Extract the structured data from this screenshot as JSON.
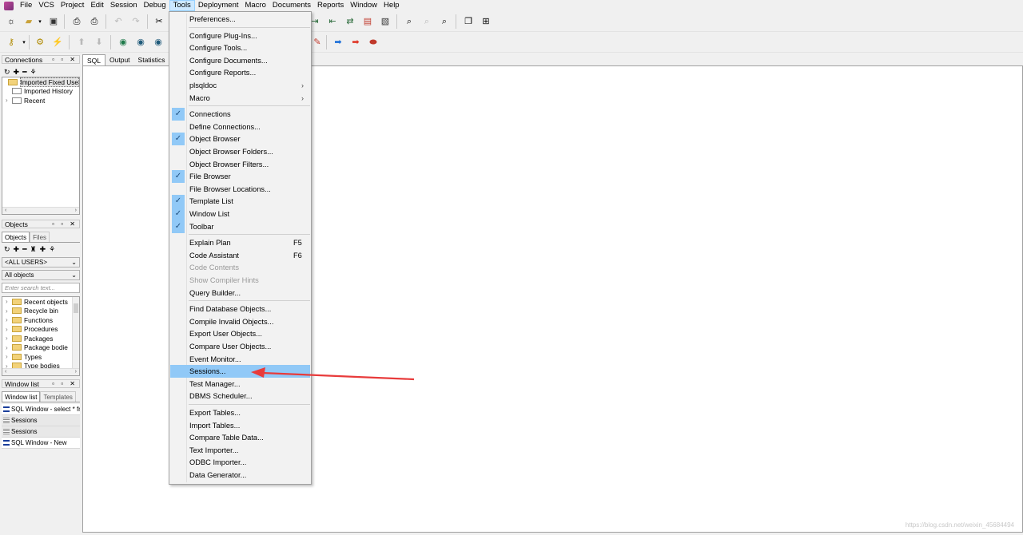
{
  "menubar": {
    "items": [
      "File",
      "VCS",
      "Project",
      "Edit",
      "Session",
      "Debug",
      "Tools",
      "Deployment",
      "Macro",
      "Documents",
      "Reports",
      "Window",
      "Help"
    ],
    "active": "Tools"
  },
  "panels": {
    "connections": {
      "title": "Connections",
      "tree": [
        "Imported Fixed Use",
        "Imported History",
        "Recent"
      ]
    },
    "objects": {
      "title": "Objects",
      "tabs": [
        "Objects",
        "Files"
      ],
      "user_select": "<ALL USERS>",
      "type_select": "All objects",
      "search_placeholder": "Enter search text...",
      "tree": [
        "Recent objects",
        "Recycle bin",
        "Functions",
        "Procedures",
        "Packages",
        "Package bodie",
        "Types",
        "Type bodies"
      ]
    },
    "window_list": {
      "title": "Window list",
      "tabs": [
        "Window list",
        "Templates"
      ],
      "items": [
        "SQL Window - select * fr",
        "Sessions",
        "Sessions",
        "SQL Window - New"
      ]
    }
  },
  "main": {
    "tabs": [
      "SQL",
      "Output",
      "Statistics"
    ],
    "active_tab": "SQL"
  },
  "tools_menu": {
    "items": [
      {
        "label": "Preferences...",
        "check": false,
        "disabled": false
      },
      {
        "sep": true
      },
      {
        "label": "Configure Plug-Ins...",
        "check": false
      },
      {
        "label": "Configure Tools...",
        "check": false
      },
      {
        "label": "Configure Documents...",
        "check": false
      },
      {
        "label": "Configure Reports...",
        "check": false
      },
      {
        "label": "plsqldoc",
        "submenu": true
      },
      {
        "label": "Macro",
        "submenu": true
      },
      {
        "sep": true
      },
      {
        "label": "Connections",
        "check": true
      },
      {
        "label": "Define Connections...",
        "check": false
      },
      {
        "label": "Object Browser",
        "check": true
      },
      {
        "label": "Object Browser Folders...",
        "check": false
      },
      {
        "label": "Object Browser Filters...",
        "check": false
      },
      {
        "label": "File Browser",
        "check": true
      },
      {
        "label": "File Browser Locations...",
        "check": false
      },
      {
        "label": "Template List",
        "check": true
      },
      {
        "label": "Window List",
        "check": true
      },
      {
        "label": "Toolbar",
        "check": true
      },
      {
        "sep": true
      },
      {
        "label": "Explain Plan",
        "shortcut": "F5"
      },
      {
        "label": "Code Assistant",
        "shortcut": "F6"
      },
      {
        "label": "Code Contents",
        "disabled": true
      },
      {
        "label": "Show Compiler Hints",
        "disabled": true
      },
      {
        "label": "Query Builder..."
      },
      {
        "sep": true
      },
      {
        "label": "Find Database Objects..."
      },
      {
        "label": "Compile Invalid Objects..."
      },
      {
        "label": "Export User Objects..."
      },
      {
        "label": "Compare User Objects..."
      },
      {
        "label": "Event Monitor..."
      },
      {
        "label": "Sessions...",
        "highlighted": true
      },
      {
        "label": "Test Manager..."
      },
      {
        "label": "DBMS Scheduler..."
      },
      {
        "sep": true
      },
      {
        "label": "Export Tables..."
      },
      {
        "label": "Import Tables..."
      },
      {
        "label": "Compare Table Data..."
      },
      {
        "label": "Text Importer..."
      },
      {
        "label": "ODBC Importer..."
      },
      {
        "label": "Data Generator..."
      }
    ]
  },
  "colors": {
    "highlight": "#91c9f7",
    "annotation_arrow": "#e83b3b"
  },
  "watermark": "https://blog.csdn.net/weixin_45684494"
}
